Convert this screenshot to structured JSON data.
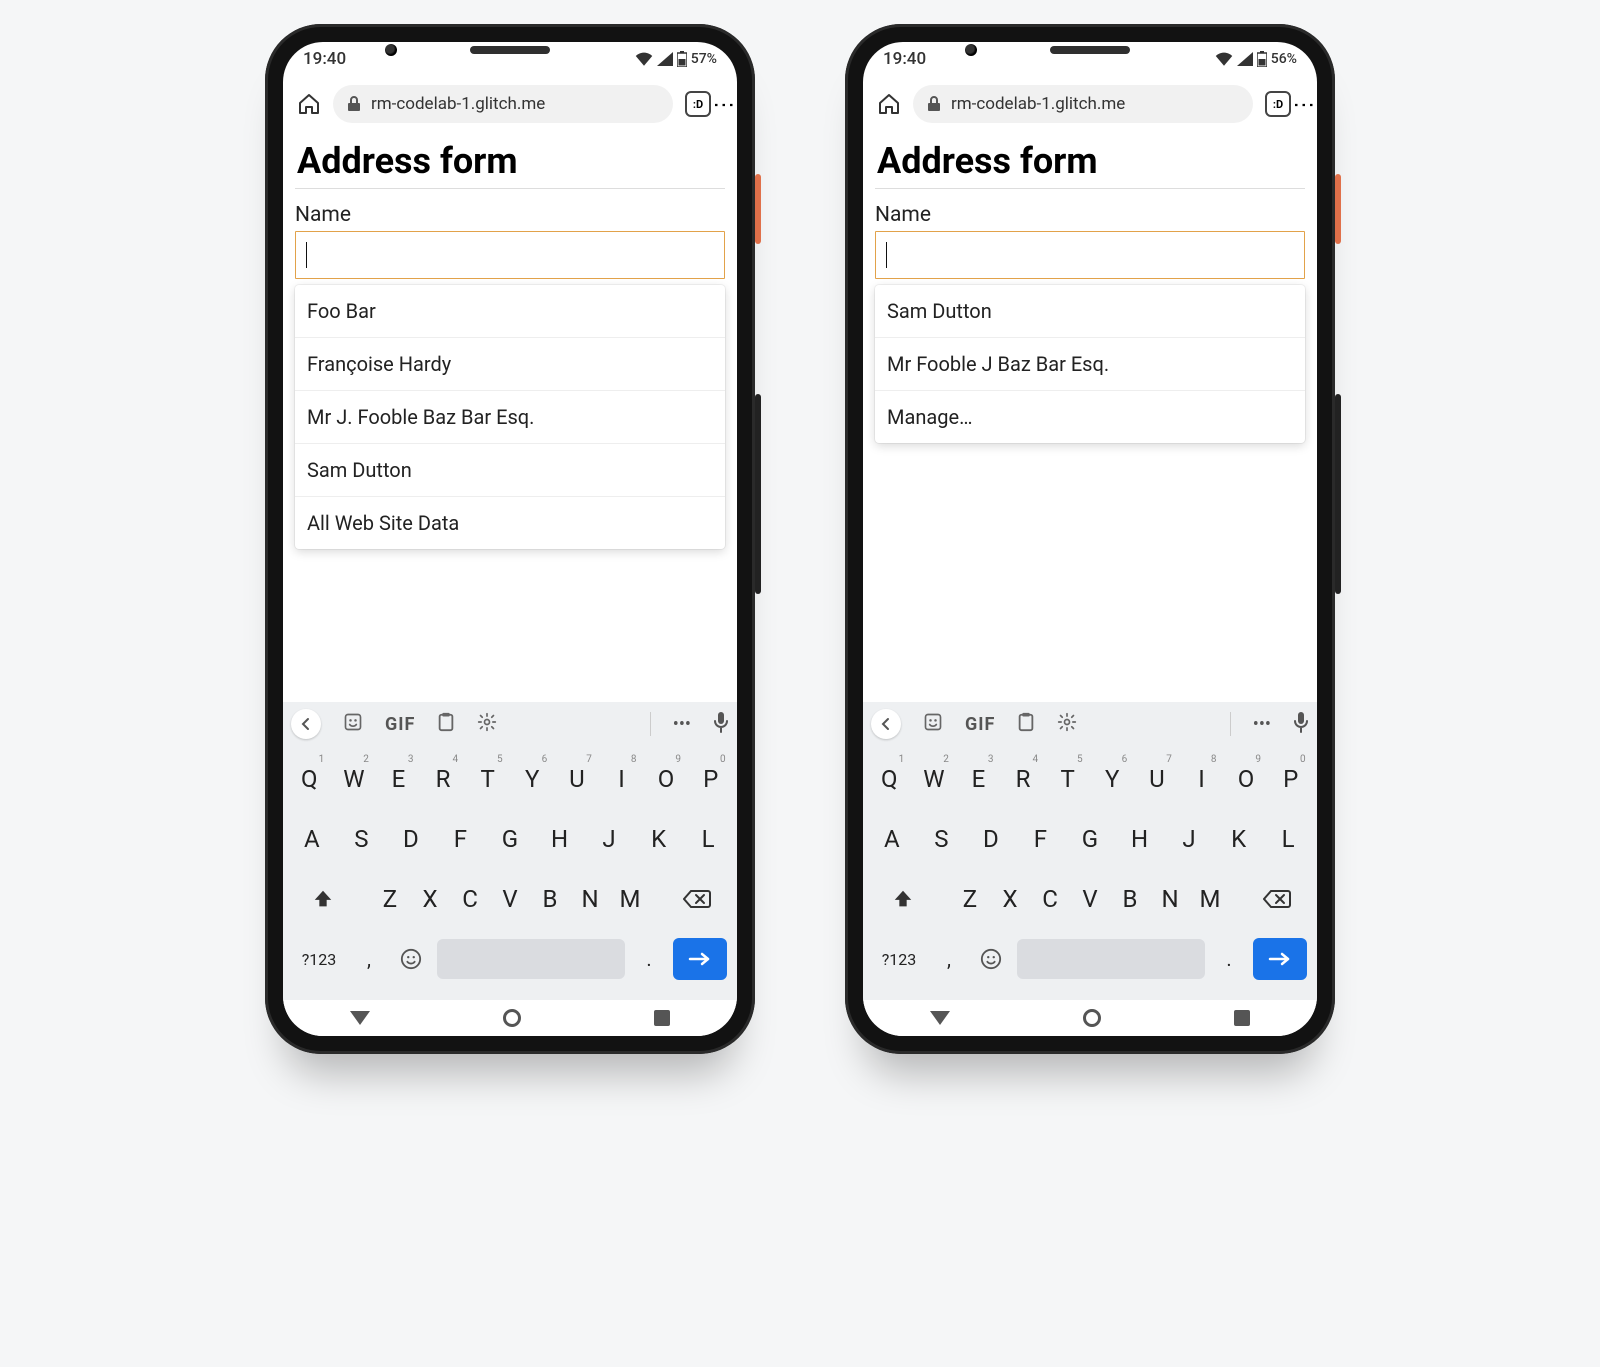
{
  "phones": [
    {
      "statusbar": {
        "time": "19:40",
        "battery": "57%"
      },
      "browser": {
        "url": "rm-codelab-1.glitch.me",
        "tab_indicator": ":D"
      },
      "page": {
        "title": "Address form",
        "name_label": "Name",
        "suggestions": [
          "Foo Bar",
          "Françoise Hardy",
          "Mr J. Fooble Baz Bar Esq.",
          "Sam Dutton",
          "All Web Site Data"
        ]
      }
    },
    {
      "statusbar": {
        "time": "19:40",
        "battery": "56%"
      },
      "browser": {
        "url": "rm-codelab-1.glitch.me",
        "tab_indicator": ":D"
      },
      "page": {
        "title": "Address form",
        "name_label": "Name",
        "suggestions": [
          "Sam Dutton",
          "Mr Fooble J Baz Bar Esq.",
          "Manage…"
        ]
      }
    }
  ],
  "keyboard": {
    "strip_gif": "GIF",
    "rows": {
      "r1": [
        {
          "k": "Q",
          "n": "1"
        },
        {
          "k": "W",
          "n": "2"
        },
        {
          "k": "E",
          "n": "3"
        },
        {
          "k": "R",
          "n": "4"
        },
        {
          "k": "T",
          "n": "5"
        },
        {
          "k": "Y",
          "n": "6"
        },
        {
          "k": "U",
          "n": "7"
        },
        {
          "k": "I",
          "n": "8"
        },
        {
          "k": "O",
          "n": "9"
        },
        {
          "k": "P",
          "n": "0"
        }
      ],
      "r2": [
        "A",
        "S",
        "D",
        "F",
        "G",
        "H",
        "J",
        "K",
        "L"
      ],
      "r3": [
        "Z",
        "X",
        "C",
        "V",
        "B",
        "N",
        "M"
      ]
    },
    "symbols_key": "?123",
    "comma_key": ",",
    "dot_key": "."
  }
}
